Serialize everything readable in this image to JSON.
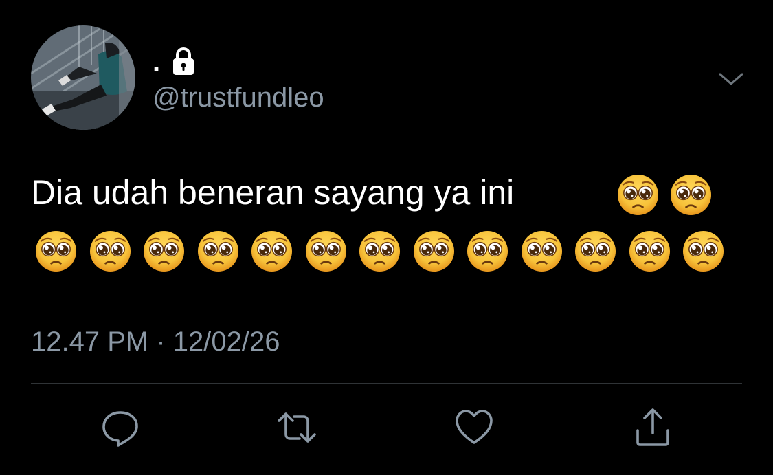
{
  "user": {
    "display_name": ".",
    "handle": "@trustfundleo",
    "lock_icon": "lock-icon",
    "avatar": "profile-photo"
  },
  "tweet": {
    "text": "Dia udah beneran sayang ya ini",
    "emoji": "pleading-face",
    "emoji_count": 15,
    "timestamp": "12.47 PM · 12/02/26"
  },
  "actions": {
    "reply_icon": "reply-icon",
    "retweet_icon": "retweet-icon",
    "like_icon": "heart-icon",
    "share_icon": "share-icon"
  },
  "colors": {
    "background": "#000000",
    "text": "#ffffff",
    "secondary": "#8b98a5",
    "divider": "#2f3336",
    "emoji_face": "#f7c23a"
  }
}
